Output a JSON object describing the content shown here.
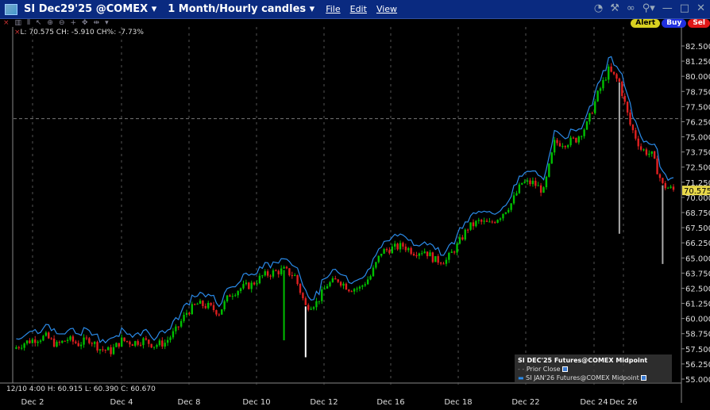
{
  "titlebar": {
    "instrument": "SI Dec29'25 @COMEX",
    "period": "1 Month/Hourly candles",
    "menus": [
      "File",
      "Edit",
      "View"
    ],
    "icons": [
      "chat-icon",
      "wrench-icon",
      "link-icon",
      "pin-icon",
      "minimize-icon",
      "maximize-icon",
      "close-icon"
    ]
  },
  "buttons": {
    "alert": "Alert",
    "buy": "Buy",
    "sell": "Sel"
  },
  "info_line": "L: 70.575 CH: -5.910 CH%: -7.73%",
  "crosshair_info": "12/10 4:00   H: 60.915   L: 60.390   C: 60.670",
  "legend": {
    "title": "SI DEC'25 Futures@COMEX Midpoint",
    "items": [
      "Prior Close",
      "SI JAN'26 Futures@COMEX Midpoint"
    ]
  },
  "colors": {
    "up": "#00c000",
    "down": "#e02020",
    "line": "#2a8ae8",
    "last_badge": "#e8d84a"
  },
  "chart_data": {
    "type": "candlestick",
    "ylim": [
      54.4,
      83.5
    ],
    "yticks": [
      "82.500",
      "81.250",
      "80.000",
      "78.750",
      "77.500",
      "76.250",
      "75.000",
      "73.750",
      "72.500",
      "71.250",
      "70.000",
      "68.750",
      "67.500",
      "66.250",
      "65.000",
      "63.750",
      "62.500",
      "61.250",
      "60.000",
      "58.750",
      "57.500",
      "56.250",
      "55.000"
    ],
    "xticks": [
      "Dec 2",
      "Dec 4",
      "Dec 8",
      "Dec 10",
      "Dec 12",
      "Dec 16",
      "Dec 18",
      "Dec 22",
      "Dec 24",
      "Dec 26"
    ],
    "last": "70.575",
    "closes": [
      57.5,
      58,
      58.3,
      58.5,
      57.8,
      58.3,
      57.9,
      58.3,
      57.5,
      57.3,
      58.2,
      58,
      58.2,
      57.8,
      58,
      59,
      60.5,
      61.2,
      61,
      60.5,
      62,
      62.5,
      62.8,
      63.5,
      63.8,
      64,
      63.5,
      61,
      61.3,
      62.8,
      63.2,
      62.5,
      62.5,
      63.5,
      65.5,
      65.8,
      66,
      65.5,
      65.6,
      64.8,
      64.8,
      66,
      67.5,
      68,
      67.8,
      68.5,
      69.5,
      71.2,
      71.2,
      70.5,
      74.5,
      74.5,
      74.8,
      76,
      78.5,
      80.5,
      79.5,
      76,
      74,
      73.5,
      71,
      70.6
    ],
    "spikes": [
      {
        "index": 25,
        "low": 58.2,
        "color": "#00c000"
      },
      {
        "index": 27,
        "low": 56.8,
        "color": "#ffffff"
      },
      {
        "index": 56,
        "low": 67,
        "color": "#aaaaaa"
      },
      {
        "index": 60,
        "low": 64.5,
        "color": "#aaaaaa"
      }
    ],
    "series_offset_jan": 0.9
  }
}
